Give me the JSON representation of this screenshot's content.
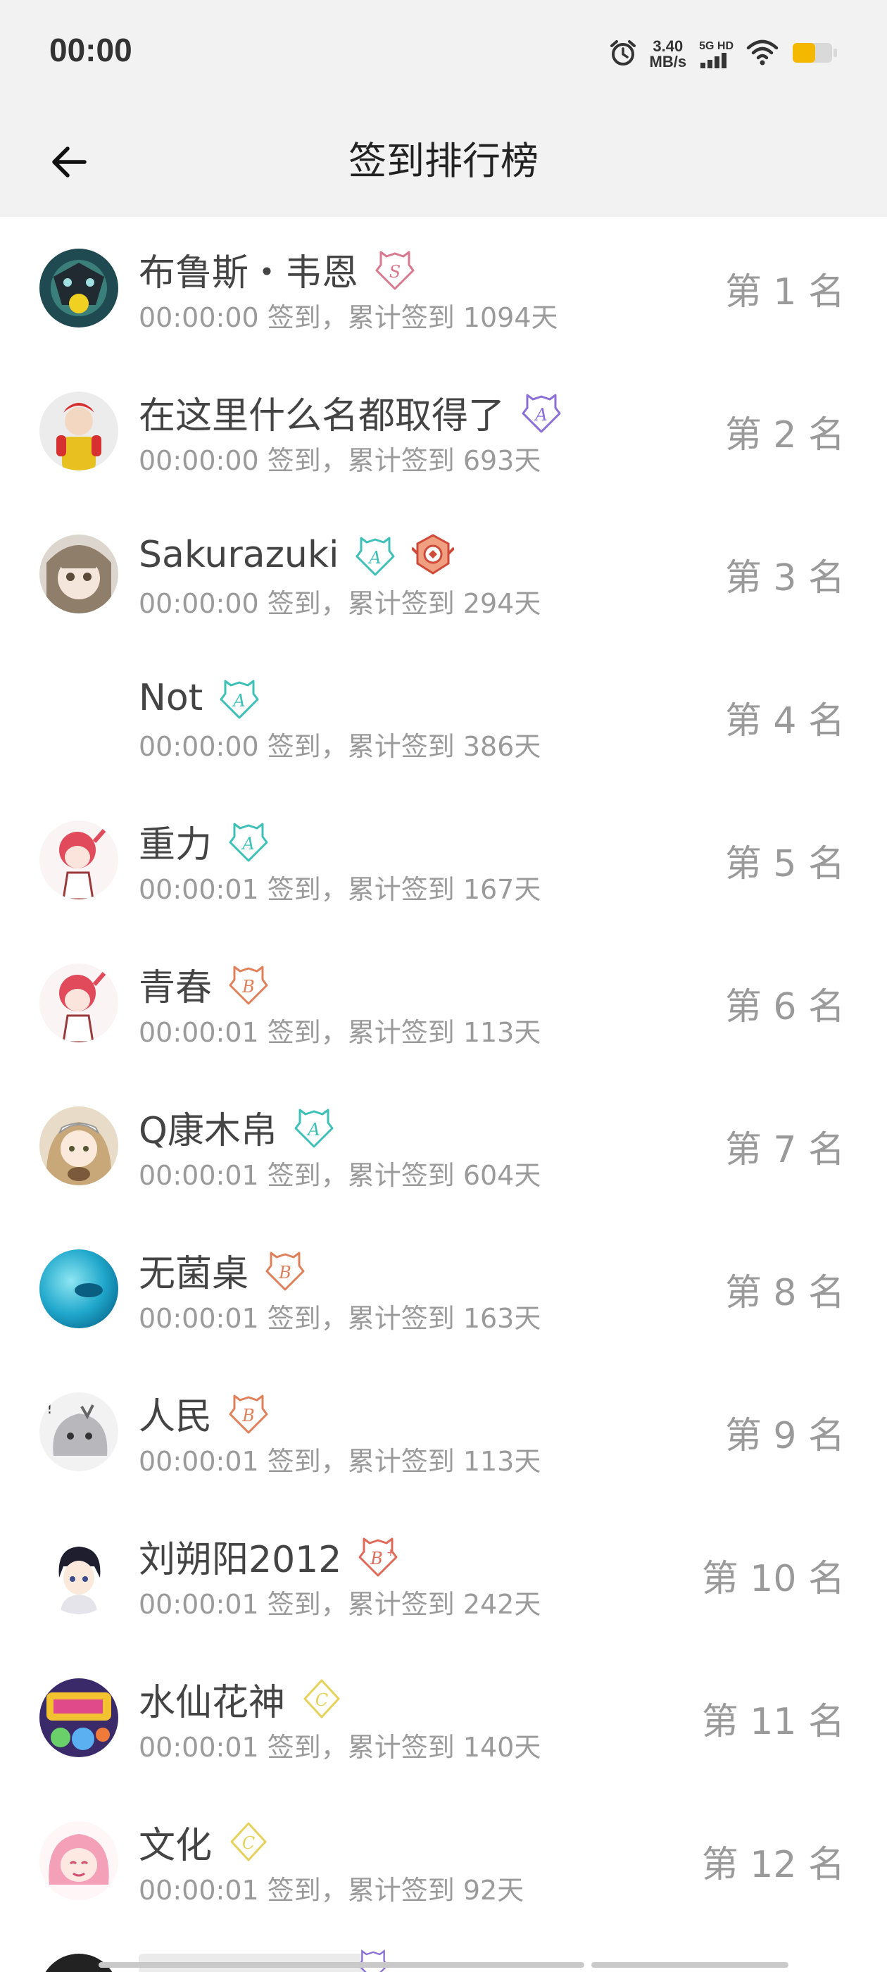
{
  "status": {
    "time": "00:00",
    "net_speed_value": "3.40",
    "net_speed_unit": "MB/s",
    "net_type": "5G HD"
  },
  "header": {
    "title": "签到排行榜"
  },
  "colors": {
    "S": "#d9788e",
    "A_purple": "#8b6fd6",
    "A_teal": "#3cc0b8",
    "B": "#e0805a",
    "C": "#e6d25a",
    "battery": "#f5b800"
  },
  "rows": [
    {
      "name": "布鲁斯・韦恩",
      "sub": "00:00:00 签到，累计签到 1094天",
      "rank": "第 1 名",
      "badges": [
        "S"
      ]
    },
    {
      "name": "在这里什么名都取得了",
      "sub": "00:00:00 签到，累计签到 693天",
      "rank": "第 2 名",
      "badges": [
        "A_purple"
      ]
    },
    {
      "name": "Sakurazuki",
      "sub": "00:00:00 签到，累计签到 294天",
      "rank": "第 3 名",
      "badges": [
        "A_teal",
        "medal"
      ]
    },
    {
      "name": "Not",
      "sub": "00:00:00 签到，累计签到 386天",
      "rank": "第 4 名",
      "badges": [
        "A_teal"
      ]
    },
    {
      "name": "重力",
      "sub": "00:00:01 签到，累计签到 167天",
      "rank": "第 5 名",
      "badges": [
        "A_teal"
      ]
    },
    {
      "name": "青春",
      "sub": "00:00:01 签到，累计签到 113天",
      "rank": "第 6 名",
      "badges": [
        "B"
      ]
    },
    {
      "name": "Q康木帛",
      "sub": "00:00:01 签到，累计签到 604天",
      "rank": "第 7 名",
      "badges": [
        "A_teal"
      ]
    },
    {
      "name": "无菌桌",
      "sub": "00:00:01 签到，累计签到 163天",
      "rank": "第 8 名",
      "badges": [
        "B"
      ]
    },
    {
      "name": "人民",
      "sub": "00:00:01 签到，累计签到 113天",
      "rank": "第 9 名",
      "badges": [
        "B"
      ]
    },
    {
      "name": "刘朔阳2012",
      "sub": "00:00:01 签到，累计签到 242天",
      "rank": "第 10 名",
      "badges": [
        "B_plus"
      ]
    },
    {
      "name": "水仙花神",
      "sub": "00:00:01 签到，累计签到 140天",
      "rank": "第 11 名",
      "badges": [
        "C"
      ]
    },
    {
      "name": "文化",
      "sub": "00:00:01 签到，累计签到 92天",
      "rank": "第 12 名",
      "badges": [
        "C"
      ]
    }
  ],
  "badge_letters": {
    "S": "S",
    "A_purple": "A",
    "A_teal": "A",
    "B": "B",
    "B_plus": "B",
    "C": "C"
  }
}
